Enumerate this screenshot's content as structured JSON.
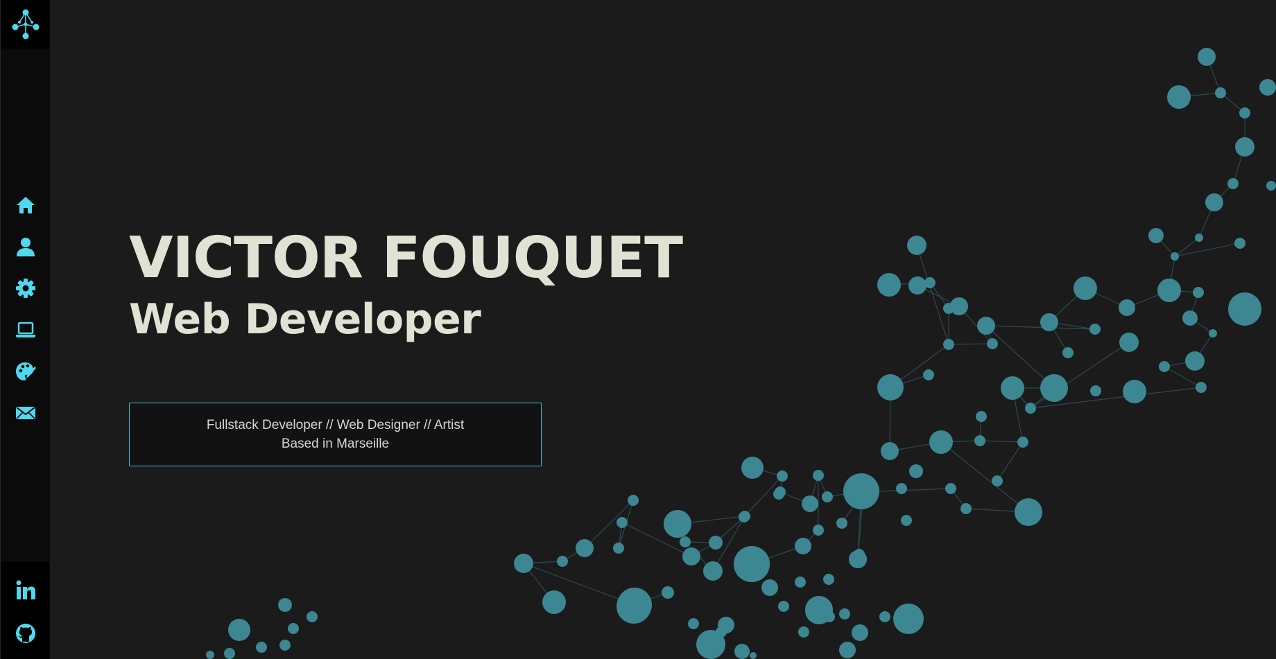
{
  "sidebar": {
    "logo_icon": "network-logo-icon",
    "nav": [
      {
        "id": "home",
        "icon": "home-icon"
      },
      {
        "id": "about",
        "icon": "user-icon"
      },
      {
        "id": "skills",
        "icon": "gear-icon"
      },
      {
        "id": "projects",
        "icon": "laptop-icon"
      },
      {
        "id": "art",
        "icon": "palette-icon"
      },
      {
        "id": "contact",
        "icon": "envelope-icon"
      }
    ],
    "social": [
      {
        "id": "linkedin",
        "icon": "linkedin-icon"
      },
      {
        "id": "github",
        "icon": "github-icon"
      }
    ]
  },
  "hero": {
    "name": "VICTOR FOUQUET",
    "role": "Web Developer",
    "tagline": "Fullstack Developer // Web Designer // Artist",
    "location": "Based in Marseille"
  },
  "colors": {
    "accent": "#4fd8ee",
    "background": "#1b1b1b",
    "sidebar": "#0b0b0b",
    "text": "#dfe3d4",
    "molecule_node": "#3d8793",
    "molecule_link": "#2d4a50"
  }
}
